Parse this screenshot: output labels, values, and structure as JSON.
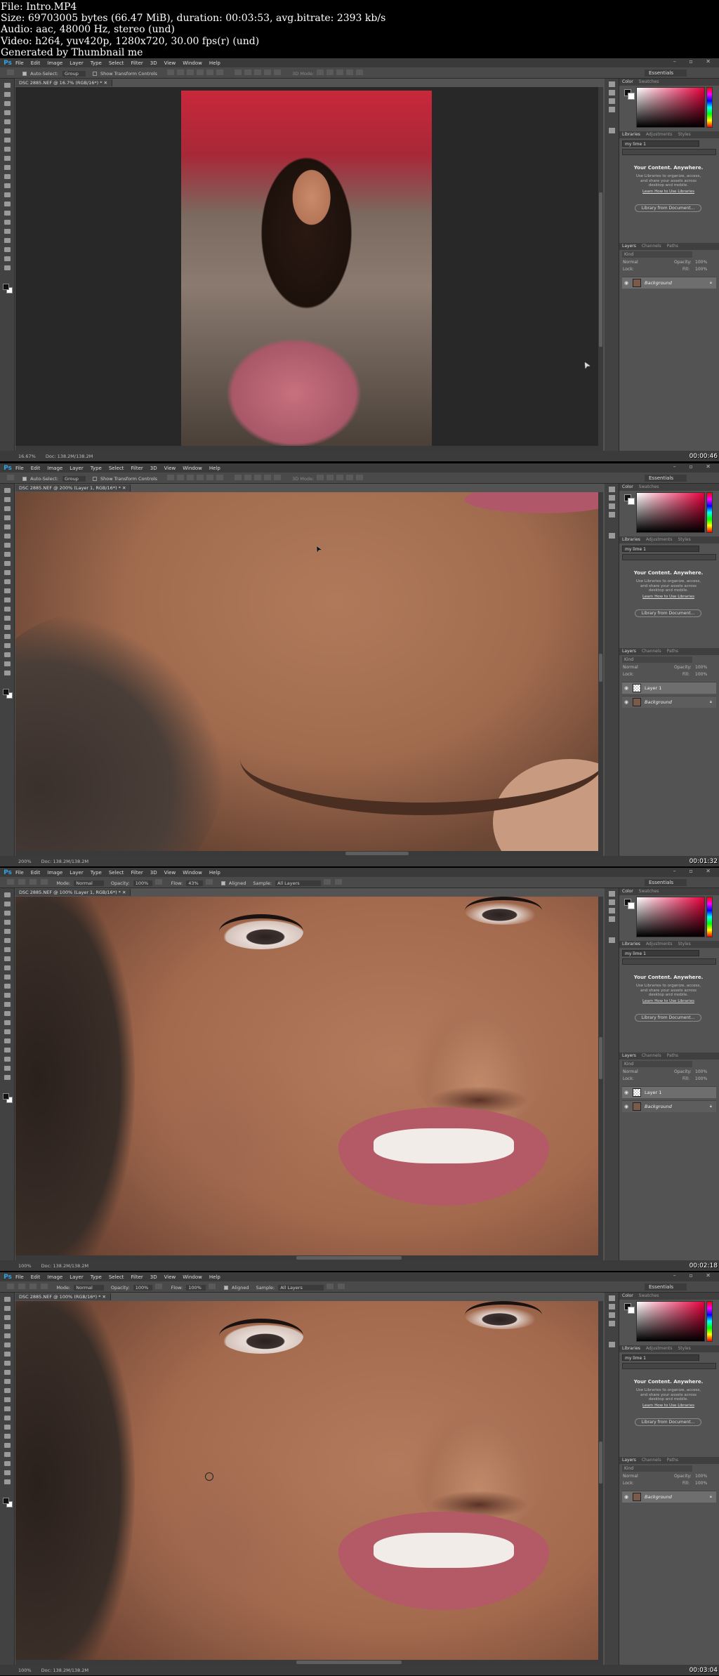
{
  "header": {
    "line1": "File: Intro.MP4",
    "line2": "Size: 69703005 bytes (66.47 MiB), duration: 00:03:53, avg.bitrate: 2393 kb/s",
    "line3": "Audio: aac, 48000 Hz, stereo (und)",
    "line4": "Video: h264, yuv420p, 1280x720, 30.00 fps(r) (und)",
    "line5": "Generated by Thumbnail me"
  },
  "menu": {
    "logo": "Ps",
    "items": [
      "File",
      "Edit",
      "Image",
      "Layer",
      "Type",
      "Select",
      "Filter",
      "3D",
      "View",
      "Window",
      "Help"
    ],
    "window_controls": "– ▫ ✕"
  },
  "workspace": "Essentials",
  "move_options": {
    "auto_select": "Auto-Select:",
    "group": "Group",
    "transform": "Show Transform Controls",
    "mode3d": "3D Mode:"
  },
  "clone_options": {
    "mode_label": "Mode:",
    "mode": "Normal",
    "opacity_label": "Opacity:",
    "opacity": "100%",
    "flow_label": "Flow:",
    "aligned": "Aligned",
    "sample_label": "Sample:",
    "sample": "All Layers"
  },
  "panels": {
    "color_tab": "Color",
    "swatches_tab": "Swatches",
    "libraries_tab": "Libraries",
    "adjustments_tab": "Adjustments",
    "styles_tab": "Styles",
    "library_name": "my lime 1",
    "promo_title": "Your Content. Anywhere.",
    "promo_body": "Use Libraries to organize, access, and share your assets across desktop and mobile.",
    "promo_link": "Learn How to Use Libraries",
    "library_button": "Library from Document...",
    "layers_tab": "Layers",
    "channels_tab": "Channels",
    "paths_tab": "Paths",
    "kind": "Kind",
    "blend": "Normal",
    "opacity_label": "Opacity:",
    "opacity": "100%",
    "lock_label": "Lock:",
    "fill_label": "Fill:",
    "fill": "100%",
    "layer1": "Layer 1",
    "background": "Background"
  },
  "frames": [
    {
      "tab": "DSC 2885.NEF @ 16.7% (RGB/16*) *",
      "zoom": "16.67%",
      "doc": "Doc: 138.2M/138.2M",
      "time": "00:00:46",
      "flow": ""
    },
    {
      "tab": "DSC 2885.NEF @ 200% (Layer 1, RGB/16*) *",
      "zoom": "200%",
      "doc": "Doc: 138.2M/138.2M",
      "time": "00:01:32",
      "flow": ""
    },
    {
      "tab": "DSC 2885.NEF @ 100% (Layer 1, RGB/16*) *",
      "zoom": "100%",
      "doc": "Doc: 138.2M/138.2M",
      "time": "00:02:18",
      "flow": "43%"
    },
    {
      "tab": "DSC 2885.NEF @ 100% (RGB/16*) *",
      "zoom": "100%",
      "doc": "Doc: 138.2M/138.2M",
      "time": "00:03:04",
      "flow": "100%"
    }
  ]
}
